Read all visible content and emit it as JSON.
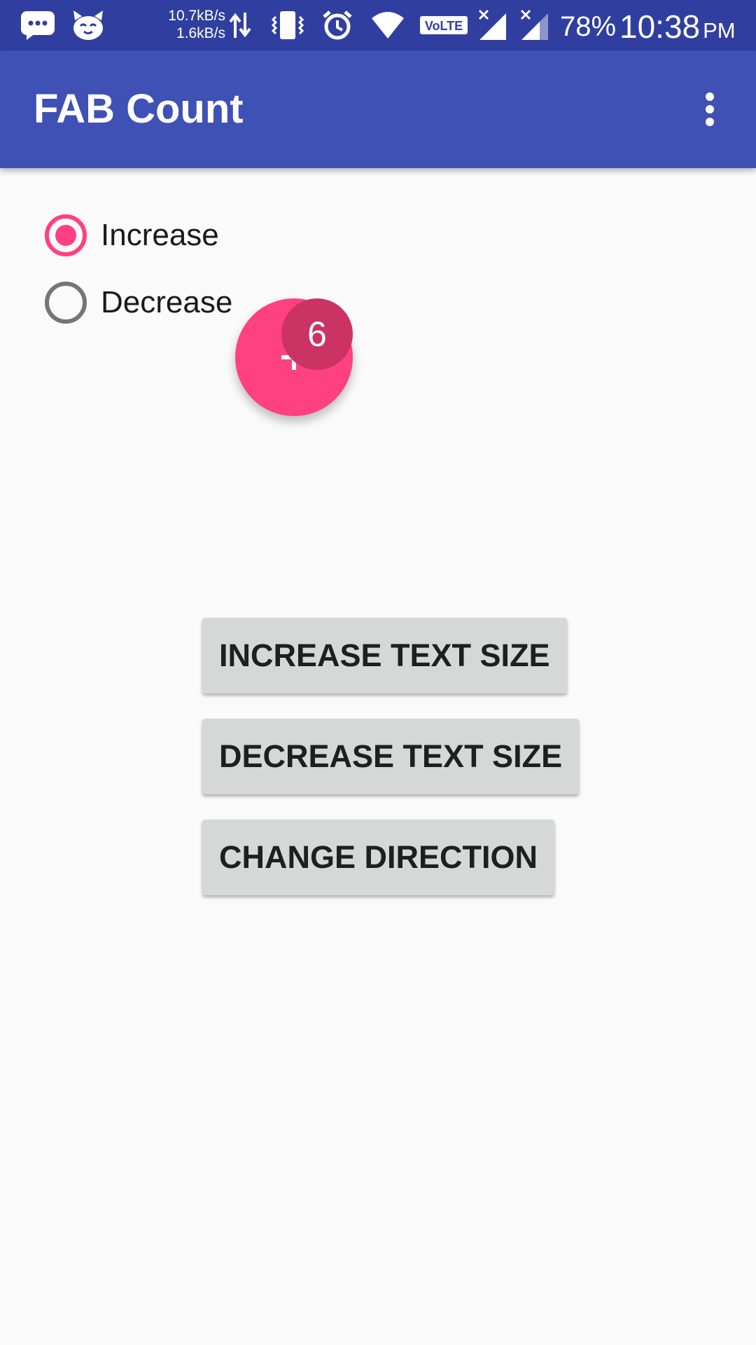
{
  "status_bar": {
    "upload_speed": "10.7kB/s",
    "download_speed": "1.6kB/s",
    "battery": "78%",
    "time": "10:38",
    "ampm": "PM",
    "volte_label": "VoLTE",
    "icons": [
      "message-icon",
      "app-face-icon",
      "data-transfer-icon",
      "vibrate-icon",
      "alarm-icon",
      "wifi-icon",
      "volte-icon",
      "signal-icon",
      "signal-icon"
    ]
  },
  "app_bar": {
    "title": "FAB Count",
    "menu_icon": "more-vert-icon",
    "color": "#3f51b5"
  },
  "radio_group": {
    "options": [
      {
        "label": "Increase",
        "checked": true
      },
      {
        "label": "Decrease",
        "checked": false
      }
    ],
    "accent": "#ff4081"
  },
  "fab": {
    "icon": "plus-icon",
    "count": "6",
    "color": "#ff4081",
    "badge_color": "#cb3364"
  },
  "buttons": {
    "increase_text_size": "INCREASE TEXT SIZE",
    "decrease_text_size": "DECREASE TEXT SIZE",
    "change_direction": "CHANGE DIRECTION"
  }
}
